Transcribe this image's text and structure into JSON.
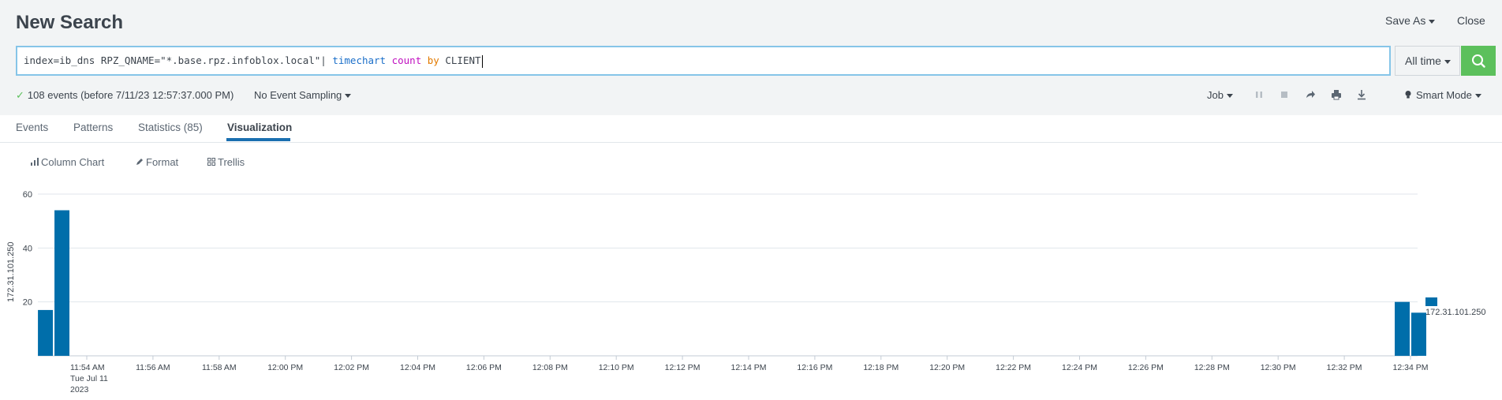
{
  "header": {
    "title": "New Search",
    "save_as": "Save As",
    "close": "Close"
  },
  "search": {
    "query_parts": [
      {
        "text": "index=ib_dns RPZ_QNAME=\"*.base.rpz.infoblox.local\"| ",
        "kind": "plain"
      },
      {
        "text": "timechart",
        "kind": "command"
      },
      {
        "text": " ",
        "kind": "plain"
      },
      {
        "text": "count",
        "kind": "function"
      },
      {
        "text": " ",
        "kind": "plain"
      },
      {
        "text": "by",
        "kind": "keyword"
      },
      {
        "text": " CLIENT",
        "kind": "plain"
      }
    ],
    "time_range": "All time",
    "submit_icon": "search-icon"
  },
  "status": {
    "events_text": "108 events (before 7/11/23 12:57:37.000 PM)",
    "sampling": "No Event Sampling",
    "job": "Job",
    "smart_mode": "Smart Mode",
    "job_icons": [
      "pause-icon",
      "stop-icon",
      "share-icon",
      "print-icon",
      "export-icon"
    ]
  },
  "tabs": [
    {
      "label": "Events",
      "active": false
    },
    {
      "label": "Patterns",
      "active": false
    },
    {
      "label": "Statistics (85)",
      "active": false
    },
    {
      "label": "Visualization",
      "active": true
    }
  ],
  "viz_toolbar": {
    "chart_type": "Column Chart",
    "format": "Format",
    "trellis": "Trellis"
  },
  "colors": {
    "bar": "#006eaa",
    "search_button": "#5cc05c",
    "active_tab": "#1a6fb0"
  },
  "chart_data": {
    "type": "bar",
    "ylabel": "172.31.101.250",
    "xlabel": "",
    "yticks": [
      "20",
      "40",
      "60"
    ],
    "ylim": [
      0,
      60
    ],
    "grid": true,
    "legend": {
      "position": "right",
      "entries": [
        "172.31.101.250"
      ]
    },
    "xticks": [
      "11:54 AM",
      "11:56 AM",
      "11:58 AM",
      "12:00 PM",
      "12:02 PM",
      "12:04 PM",
      "12:06 PM",
      "12:08 PM",
      "12:10 PM",
      "12:12 PM",
      "12:14 PM",
      "12:16 PM",
      "12:18 PM",
      "12:20 PM",
      "12:22 PM",
      "12:24 PM",
      "12:26 PM",
      "12:28 PM",
      "12:30 PM",
      "12:32 PM",
      "12:34 PM"
    ],
    "first_tick_sublabel": [
      "Tue Jul 11",
      "2023"
    ],
    "series": [
      {
        "name": "172.31.101.250",
        "points": [
          {
            "x": "11:53 AM",
            "y": 17
          },
          {
            "x": "11:53:30 AM",
            "y": 54
          },
          {
            "x": "12:34 PM",
            "y": 20
          },
          {
            "x": "12:34:30 PM",
            "y": 16
          }
        ]
      }
    ]
  }
}
